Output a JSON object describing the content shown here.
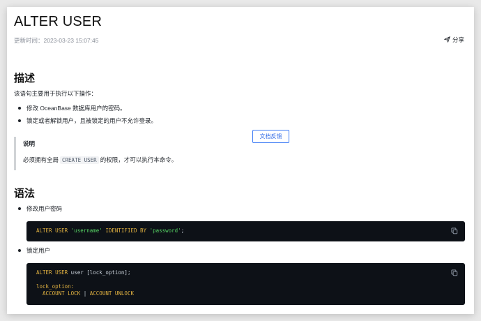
{
  "page": {
    "title": "ALTER USER",
    "updated": "更新时间：2023-03-23 15:07:45",
    "share_label": "分享"
  },
  "section_desc": {
    "heading": "描述",
    "intro": "该语句主要用于执行以下操作：",
    "bullets": [
      "修改 OceanBase 数据库用户的密码。",
      "锁定或者解锁用户，且被锁定的用户不允许登录。"
    ],
    "note": {
      "title": "说明",
      "text_before": "必须拥有全局",
      "code": "CREATE USER",
      "text_after": "的权限，才可以执行本命令。"
    }
  },
  "feedback_label": "文档反馈",
  "section_syntax": {
    "heading": "语法",
    "items": [
      {
        "label": "修改用户密码",
        "code_parts": {
          "kw1": "ALTER USER",
          "user": "'username'",
          "kw2": "IDENTIFIED BY",
          "pwd": "'password'",
          "end": ";"
        }
      },
      {
        "label": "锁定用户",
        "code_parts": {
          "kw1": "ALTER USER",
          "rest": " user [lock_option];",
          "opt_label": "lock_option:",
          "opt_indent": "  ",
          "opt1": "ACCOUNT LOCK",
          "sep": " | ",
          "opt2": "ACCOUNT UNLOCK"
        }
      }
    ]
  },
  "colors": {
    "accent": "#2f6ae6",
    "code_bg": "#0d1117",
    "keyword": "#e3b341"
  },
  "icons": [
    "send-icon",
    "copy-icon"
  ]
}
